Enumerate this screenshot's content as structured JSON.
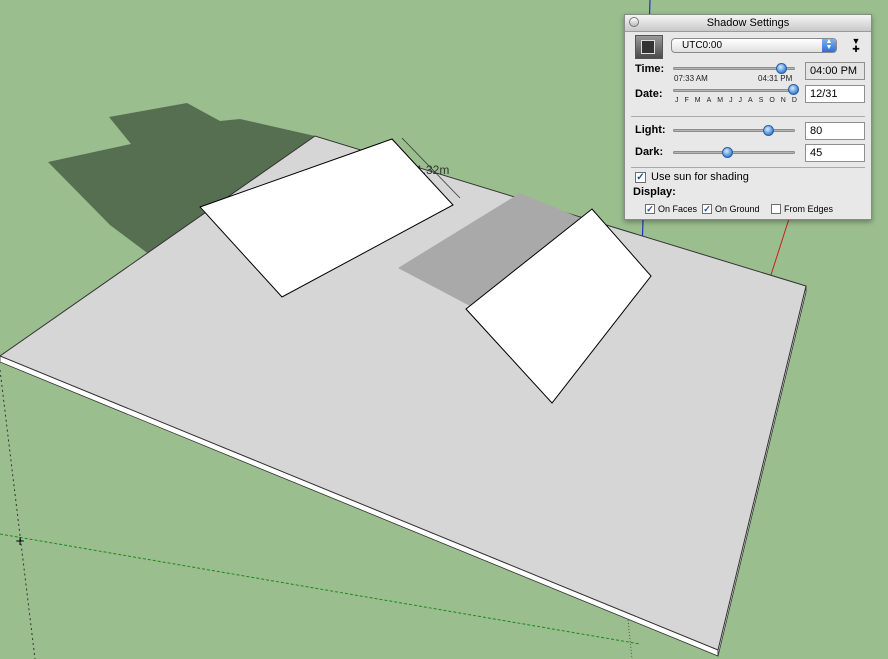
{
  "canvas": {
    "dimension_label": "1.32m",
    "colors": {
      "ground": "#9bbe8f",
      "slab": "#d6d6d6",
      "panel_face": "#ffffff",
      "shadow_ground": "#566f51",
      "shadow_slab": "#a9a9a9",
      "axis_blue": "#2330c8",
      "axis_red": "#c81e1e",
      "axis_green": "#1a9a1a"
    }
  },
  "shadow_panel": {
    "title": "Shadow Settings",
    "timezone": "UTC0:00",
    "time": {
      "label": "Time:",
      "start": "07:33 AM",
      "end": "04:31 PM",
      "value": "04:00 PM",
      "slider_fraction": 0.89
    },
    "date": {
      "label": "Date:",
      "months": [
        "J",
        "F",
        "M",
        "A",
        "M",
        "J",
        "J",
        "A",
        "S",
        "O",
        "N",
        "D"
      ],
      "value": "12/31",
      "slider_fraction": 0.99
    },
    "light": {
      "label": "Light:",
      "value": "80",
      "slider_fraction": 0.78
    },
    "dark": {
      "label": "Dark:",
      "value": "45",
      "slider_fraction": 0.45
    },
    "use_sun": {
      "label": "Use sun for shading",
      "checked": true
    },
    "display": {
      "label": "Display:",
      "on_faces": {
        "label": "On Faces",
        "checked": true
      },
      "on_ground": {
        "label": "On Ground",
        "checked": true
      },
      "from_edges": {
        "label": "From Edges",
        "checked": false
      }
    }
  }
}
